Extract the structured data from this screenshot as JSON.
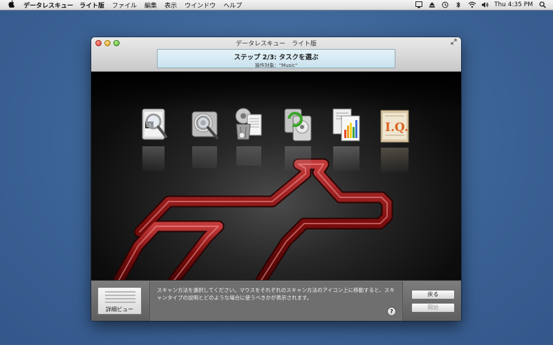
{
  "menubar": {
    "app_name": "データレスキュー　ライト版",
    "items": [
      "ファイル",
      "編集",
      "表示",
      "ウインドウ",
      "ヘルプ"
    ],
    "clock": "Thu 4:35 PM"
  },
  "window": {
    "title": "データレスキュー　ライト版",
    "step_title": "ステップ 2/3: タスクを選ぶ",
    "step_target": "操作対象：\"Music\""
  },
  "bottom": {
    "detail_view_label": "詳細ビュー",
    "description": "スキャン方法を選択してください。マウスをそれぞれのスキャン方法のアイコン上に移動すると、スキャンタイプの説明とどのような場合に使うべきかが表示されます。",
    "help_label": "?",
    "back_label": "戻る",
    "start_label": "開始"
  },
  "icons": [
    "quick-scan-icon",
    "thorough-scan-icon",
    "deleted-files-scan-icon",
    "clone-drive-icon",
    "file-preview-icon",
    "iq-icon"
  ],
  "colors": {
    "desktop": "#3c6396",
    "path_red": "#8b1212",
    "step_panel": "#d6ebf4"
  }
}
